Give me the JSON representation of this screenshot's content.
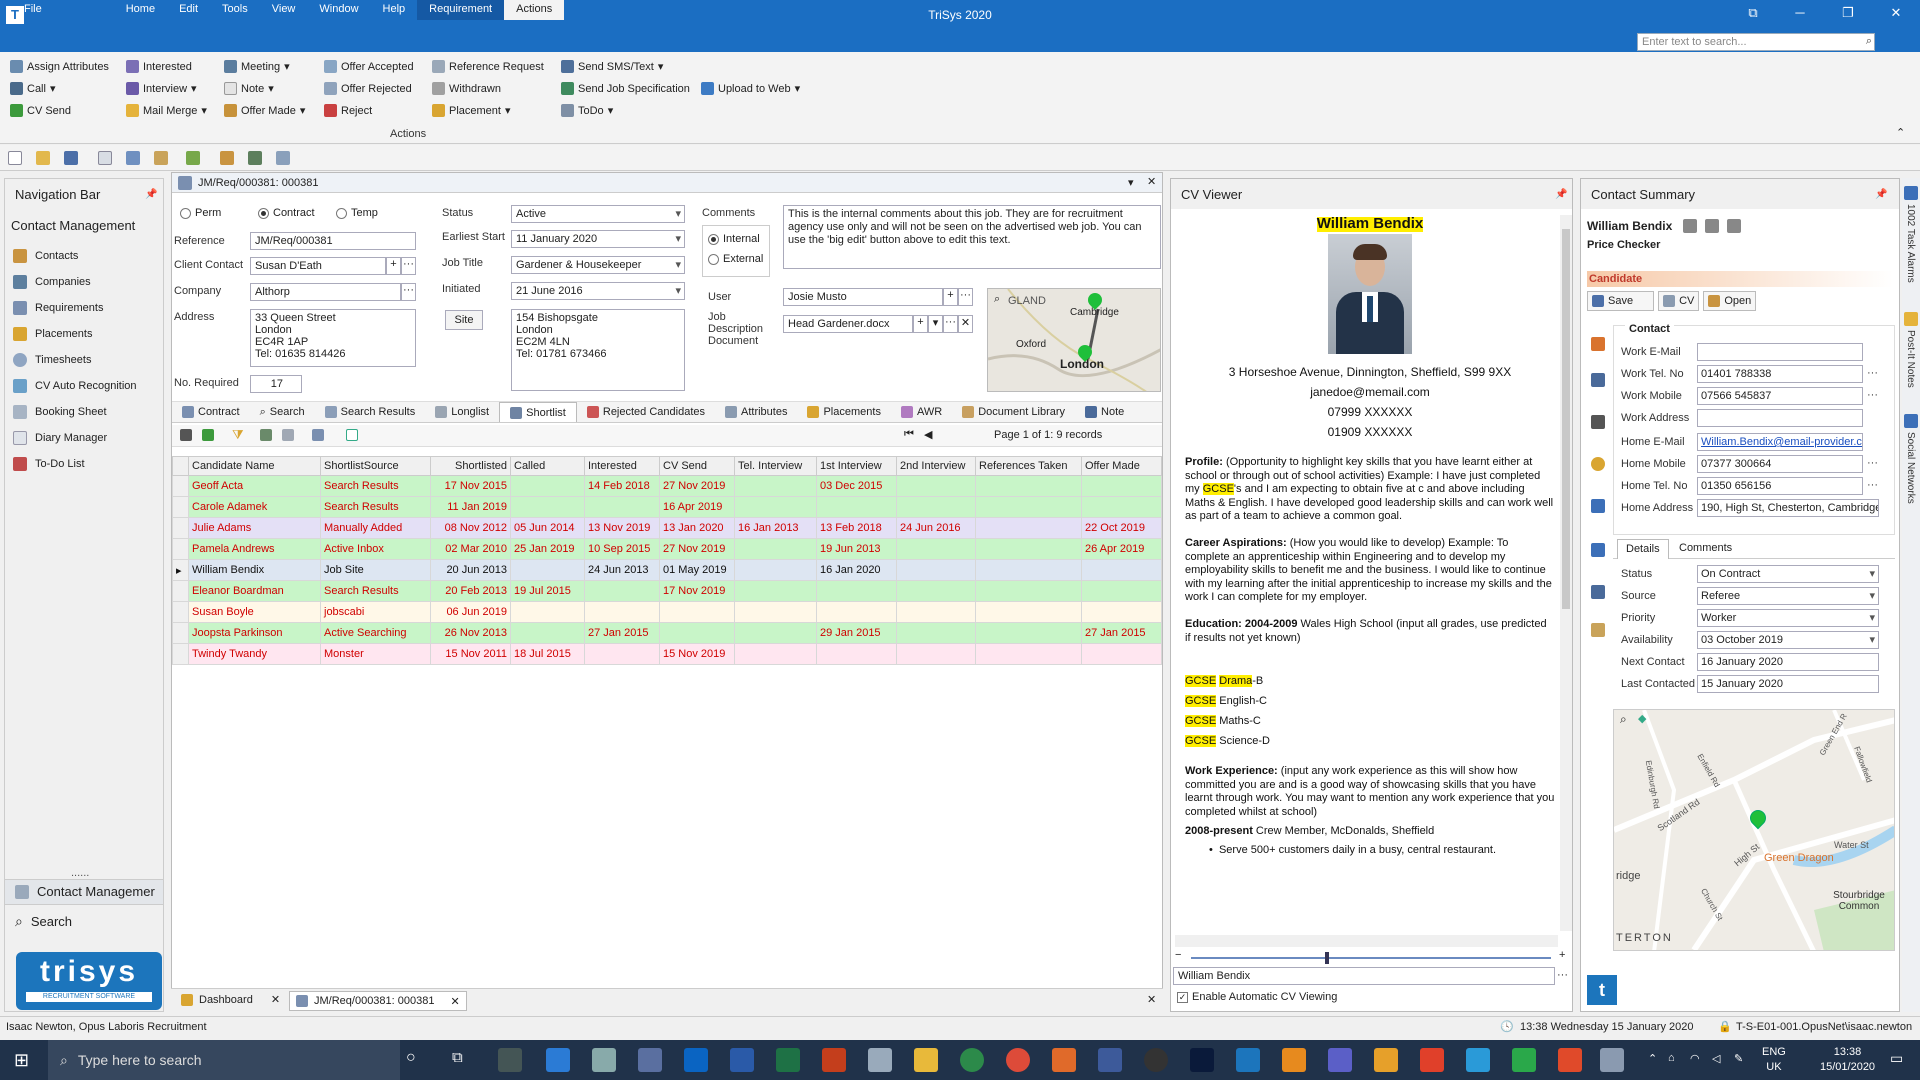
{
  "window": {
    "title": "TriSys 2020",
    "search_placeholder": "Enter text to search..."
  },
  "menu": [
    "File",
    "Home",
    "Edit",
    "Tools",
    "View",
    "Window",
    "Help",
    "Requirement",
    "Actions"
  ],
  "ribbon": {
    "group": "Actions",
    "col1": [
      "Assign Attributes",
      "Call",
      "CV Send"
    ],
    "col2": [
      "Interested",
      "Interview",
      "Mail Merge"
    ],
    "col3": [
      "Meeting",
      "Note",
      "Offer Made"
    ],
    "col4": [
      "Offer Accepted",
      "Offer Rejected",
      "Reject"
    ],
    "col5": [
      "Reference Request",
      "Withdrawn",
      "Placement"
    ],
    "col6": [
      "Send SMS/Text",
      "Send Job Specification",
      "ToDo"
    ],
    "col7": [
      "Upload to Web"
    ]
  },
  "nav": {
    "title": "Navigation Bar",
    "section": "Contact Management",
    "items": [
      "Contacts",
      "Companies",
      "Requirements",
      "Placements",
      "Timesheets",
      "CV Auto Recognition",
      "Booking Sheet",
      "Diary Manager",
      "To-Do List"
    ],
    "dots": "......",
    "bottom": [
      "Contact Managemer",
      "Search"
    ],
    "logo": "trisys",
    "logo_sub": "RECRUITMENT SOFTWARE"
  },
  "req": {
    "tab_title": "JM/Req/000381: 000381",
    "types": [
      "Perm",
      "Contract",
      "Temp"
    ],
    "labels": {
      "reference": "Reference",
      "client_contact": "Client Contact",
      "company": "Company",
      "address": "Address",
      "no_required": "No. Required",
      "status": "Status",
      "earliest_start": "Earliest Start",
      "job_title": "Job Title",
      "initiated": "Initiated",
      "comments": "Comments",
      "user": "User",
      "job_desc": "Job Description Document",
      "site": "Site"
    },
    "values": {
      "reference": "JM/Req/000381",
      "client_contact": "Susan D'Eath",
      "company": "Althorp",
      "address": [
        "33 Queen Street",
        "London",
        "EC4R 1AP",
        "Tel: 01635 814426"
      ],
      "no_required": "17",
      "status": "Active",
      "earliest_start": "11 January 2020",
      "job_title": "Gardener & Housekeeper",
      "initiated": "21 June 2016",
      "site_address": [
        "154 Bishopsgate",
        "London",
        "EC2M 4LN",
        "Tel: 01781 673466"
      ],
      "comments": "This is the internal comments about this job. They are for recruitment agency use only and will not be seen on the advertised web job. You can use the 'big edit' button above to edit this text.",
      "internal": "Internal",
      "external": "External",
      "user": "Josie Musto",
      "job_desc": "Head Gardener.docx"
    },
    "map_labels": [
      "GLAND",
      "Cambridge",
      "Oxford",
      "London"
    ],
    "tabs": [
      "Contract",
      "Search",
      "Search Results",
      "Longlist",
      "Shortlist",
      "Rejected Candidates",
      "Attributes",
      "Placements",
      "AWR",
      "Document Library",
      "Note"
    ],
    "paging": "Page 1 of 1: 9 records",
    "columns": [
      "Candidate Name",
      "ShortlistSource",
      "Shortlisted",
      "Called",
      "Interested",
      "CV Send",
      "Tel. Interview",
      "1st Interview",
      "2nd Interview",
      "References Taken",
      "Offer Made"
    ],
    "rows": [
      [
        "Geoff Acta",
        "Search Results",
        "17 Nov 2015",
        "",
        "14 Feb 2018",
        "27 Nov 2019",
        "",
        "03 Dec 2015",
        "",
        "",
        ""
      ],
      [
        "Carole Adamek",
        "Search Results",
        "11 Jan 2019",
        "",
        "",
        "16 Apr 2019",
        "",
        "",
        "",
        "",
        ""
      ],
      [
        "Julie Adams",
        "Manually Added",
        "08 Nov 2012",
        "05 Jun 2014",
        "13 Nov 2019",
        "13 Jan 2020",
        "16 Jan 2013",
        "13 Feb 2018",
        "24 Jun 2016",
        "",
        "22 Oct 2019"
      ],
      [
        "Pamela Andrews",
        "Active Inbox",
        "02 Mar 2010",
        "25 Jan 2019",
        "10 Sep 2015",
        "27 Nov 2019",
        "",
        "19 Jun 2013",
        "",
        "",
        "26 Apr 2019"
      ],
      [
        "William Bendix",
        "Job Site",
        "20 Jun 2013",
        "",
        "24 Jun 2013",
        "01 May 2019",
        "",
        "16 Jan 2020",
        "",
        "",
        ""
      ],
      [
        "Eleanor Boardman",
        "Search Results",
        "20 Feb 2013",
        "19 Jul 2015",
        "",
        "17 Nov 2019",
        "",
        "",
        "",
        "",
        ""
      ],
      [
        "Susan Boyle",
        "jobscabi",
        "06 Jun 2019",
        "",
        "",
        "",
        "",
        "",
        "",
        "",
        ""
      ],
      [
        "Joopsta Parkinson",
        "Active Searching",
        "26 Nov 2013",
        "",
        "27 Jan 2015",
        "",
        "",
        "29 Jan 2015",
        "",
        "",
        "27 Jan 2015"
      ],
      [
        "Twindy Twandy",
        "Monster",
        "15 Nov 2011",
        "18 Jul 2015",
        "",
        "15 Nov 2019",
        "",
        "",
        "",
        "",
        ""
      ]
    ]
  },
  "doc_tabs": [
    "Dashboard",
    "JM/Req/000381: 000381"
  ],
  "cv": {
    "title": "CV Viewer",
    "name": "William Bendix",
    "address": "3 Horseshoe Avenue, Dinnington, Sheffield, S99 9XX",
    "email": "janedoe@memail.com",
    "phone1": "07999 XXXXXX",
    "phone2": "01909 XXXXXX",
    "profile_h": "Profile:",
    "profile_a": " (Opportunity to highlight key skills that you have learnt either at school or through out of school activities) Example: I have just completed my ",
    "profile_gcse": "GCSE",
    "profile_b": "'s and I am expecting to obtain five at c and above including Maths & English. I have developed good leadership skills and can work well as part of a team to achieve a common goal.",
    "career_h": "Career Aspirations:",
    "career": " (How you would like to develop) Example: To complete an apprenticeship within Engineering and to develop my employability skills to benefit me and the business. I would like to continue with my learning after the initial apprenticeship to increase my skills and the work I can complete for my employer.",
    "edu_h": "Education: 2004-2009",
    "edu": " Wales High School (input all grades, use predicted if results not yet known)",
    "gcse": [
      {
        "k": "GCSE",
        "d": "Drama",
        "g": "-B"
      },
      {
        "k": "GCSE",
        "d": "",
        "g": " English-C"
      },
      {
        "k": "GCSE",
        "d": "",
        "g": " Maths-C"
      },
      {
        "k": "GCSE",
        "d": "",
        "g": " Science-D"
      }
    ],
    "work_h": "Work Experience:",
    "work": " (input any work experience as this will show how committed you are and is a good way of showcasing skills that you have learnt through work. You may want to mention any work experience that you completed whilst at school)",
    "job_h": "2008-present",
    "job": " Crew Member, McDonalds, Sheffield",
    "bullet": "Serve 500+ customers daily in a busy, central restaurant.",
    "footer_name": "William Bendix",
    "auto_view": "Enable Automatic CV Viewing"
  },
  "cs": {
    "title": "Contact Summary",
    "name": "William Bendix",
    "job": "Price Checker",
    "type": "Candidate",
    "buttons": [
      "Save",
      "CV",
      "Open"
    ],
    "section": "Contact",
    "labels": [
      "Work E-Mail",
      "Work Tel. No",
      "Work Mobile",
      "Work Address",
      "Home E-Mail",
      "Home Mobile",
      "Home Tel. No",
      "Home Address"
    ],
    "values": [
      "",
      "01401 788338",
      "07566 545837",
      "",
      "William.Bendix@email-provider.com",
      "07377 300664",
      "01350 656156",
      "190, High St, Chesterton, Cambridge"
    ],
    "tabs": [
      "Details",
      "Comments"
    ],
    "dlabels": [
      "Status",
      "Source",
      "Priority",
      "Availability",
      "Next Contact",
      "Last Contacted"
    ],
    "dvalues": [
      "On Contract",
      "Referee",
      "Worker",
      "03 October 2019",
      "16 January 2020",
      "15 January 2020"
    ],
    "map_labels": [
      "Scotland Rd",
      "High St",
      "Green Dragon",
      "Water St",
      "Stourbridge Common",
      "ridge",
      "TERTON",
      "Enfield Rd",
      "Green End R",
      "Fallowfield",
      "Church St",
      "Edinburgh Rd"
    ]
  },
  "strip": [
    "1002 Task Alarms",
    "Post-It Notes",
    "Social Networks"
  ],
  "status": {
    "user": "Isaac Newton, Opus Laboris Recruitment",
    "time": "13:38 Wednesday 15 January 2020",
    "server": "T-S-E01-001.OpusNet\\isaac.newton"
  },
  "taskbar": {
    "search": "Type here to search",
    "lang": "ENG",
    "region": "UK",
    "time": "13:38",
    "date": "15/01/2020"
  },
  "colors": {
    "accent": "#1b6ec2",
    "row_green": "#c8f5c8",
    "highlight": "#ffee00"
  }
}
